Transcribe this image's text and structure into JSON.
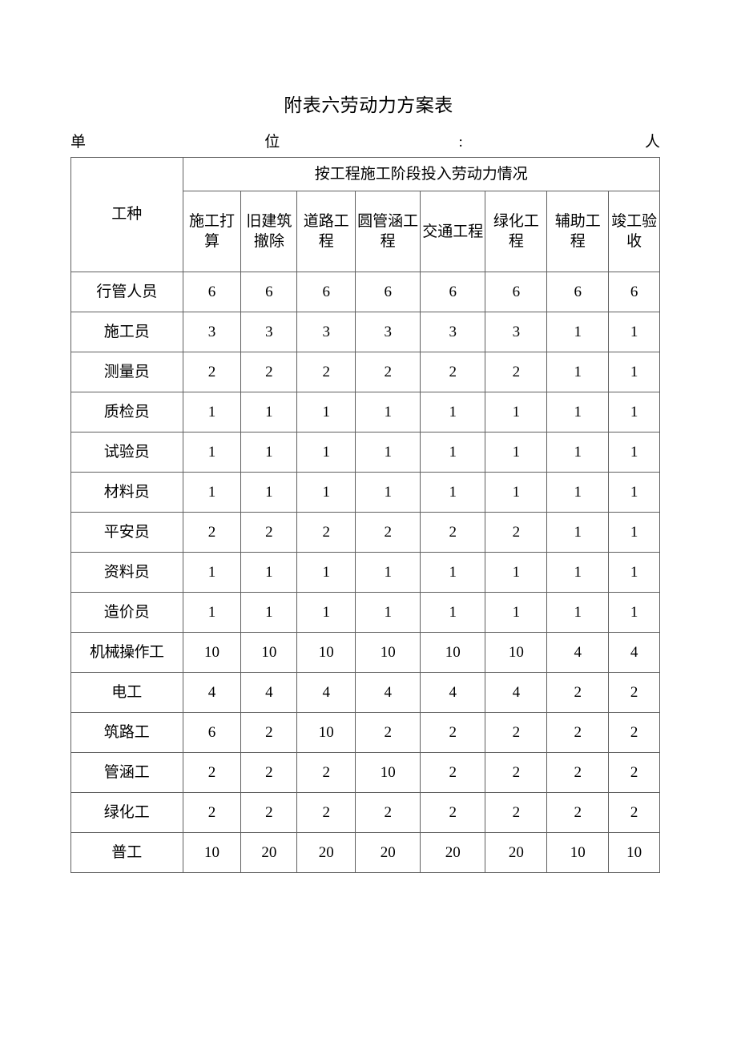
{
  "document": {
    "title": "附表六劳动力方案表",
    "unit_line": {
      "label_1": "单",
      "label_2": "位",
      "colon": ":",
      "label_3": "人"
    }
  },
  "table": {
    "kind_header": "工种",
    "group_header": "按工程施工阶段投入劳动力情况",
    "stage_headers": [
      "施工打算",
      "旧建筑撤除",
      "道路工程",
      "圆管涵工程",
      "交通工程",
      "绿化工程",
      "辅助工程",
      "竣工验收"
    ],
    "rows": [
      {
        "kind": "行管人员",
        "values": [
          "6",
          "6",
          "6",
          "6",
          "6",
          "6",
          "6",
          "6"
        ]
      },
      {
        "kind": "施工员",
        "values": [
          "3",
          "3",
          "3",
          "3",
          "3",
          "3",
          "1",
          "1"
        ]
      },
      {
        "kind": "测量员",
        "values": [
          "2",
          "2",
          "2",
          "2",
          "2",
          "2",
          "1",
          "1"
        ]
      },
      {
        "kind": "质检员",
        "values": [
          "1",
          "1",
          "1",
          "1",
          "1",
          "1",
          "1",
          "1"
        ]
      },
      {
        "kind": "试验员",
        "values": [
          "1",
          "1",
          "1",
          "1",
          "1",
          "1",
          "1",
          "1"
        ]
      },
      {
        "kind": "材料员",
        "values": [
          "1",
          "1",
          "1",
          "1",
          "1",
          "1",
          "1",
          "1"
        ]
      },
      {
        "kind": "平安员",
        "values": [
          "2",
          "2",
          "2",
          "2",
          "2",
          "2",
          "1",
          "1"
        ]
      },
      {
        "kind": "资料员",
        "values": [
          "1",
          "1",
          "1",
          "1",
          "1",
          "1",
          "1",
          "1"
        ]
      },
      {
        "kind": "造价员",
        "values": [
          "1",
          "1",
          "1",
          "1",
          "1",
          "1",
          "1",
          "1"
        ]
      },
      {
        "kind": "机械操作工",
        "values": [
          "10",
          "10",
          "10",
          "10",
          "10",
          "10",
          "4",
          "4"
        ]
      },
      {
        "kind": "电工",
        "values": [
          "4",
          "4",
          "4",
          "4",
          "4",
          "4",
          "2",
          "2"
        ]
      },
      {
        "kind": "筑路工",
        "values": [
          "6",
          "2",
          "10",
          "2",
          "2",
          "2",
          "2",
          "2"
        ]
      },
      {
        "kind": "管涵工",
        "values": [
          "2",
          "2",
          "2",
          "10",
          "2",
          "2",
          "2",
          "2"
        ]
      },
      {
        "kind": "绿化工",
        "values": [
          "2",
          "2",
          "2",
          "2",
          "2",
          "2",
          "2",
          "2"
        ]
      },
      {
        "kind": "普工",
        "values": [
          "10",
          "20",
          "20",
          "20",
          "20",
          "20",
          "10",
          "10"
        ]
      }
    ]
  },
  "style": {
    "border_color": "#5f5f5f",
    "text_color": "#000000",
    "background": "#ffffff"
  }
}
